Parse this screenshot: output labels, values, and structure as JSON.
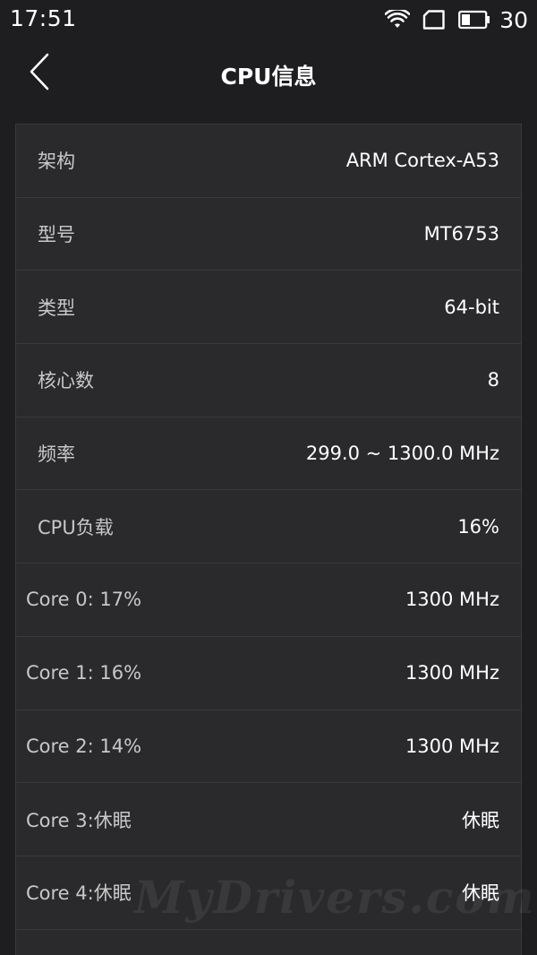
{
  "status_bar": {
    "time": "17:51",
    "battery_level": "30",
    "icons": [
      "wifi-icon",
      "sim-icon",
      "battery-icon"
    ]
  },
  "header": {
    "title": "CPU信息",
    "back_icon": "chevron-left-icon"
  },
  "rows": [
    {
      "label": "架构",
      "value": "ARM Cortex-A53"
    },
    {
      "label": "型号",
      "value": "MT6753"
    },
    {
      "label": "类型",
      "value": "64-bit"
    },
    {
      "label": "核心数",
      "value": "8"
    },
    {
      "label": "频率",
      "value": "299.0 ~ 1300.0 MHz"
    },
    {
      "label": "CPU负载",
      "value": "16%"
    },
    {
      "label": "Core 0: 17%",
      "value": "1300 MHz"
    },
    {
      "label": "Core 1: 16%",
      "value": "1300 MHz"
    },
    {
      "label": "Core 2: 14%",
      "value": "1300 MHz"
    },
    {
      "label": "Core 3:休眠",
      "value": "休眠"
    },
    {
      "label": "Core 4:休眠",
      "value": "休眠"
    },
    {
      "label": "",
      "value": ""
    }
  ],
  "watermark": "MyDrivers.com",
  "colors": {
    "background": "#1e1e20",
    "card": "#2a2a2d",
    "divider": "#3a3a3d",
    "label": "#c8c8c8",
    "value": "#ffffff"
  }
}
